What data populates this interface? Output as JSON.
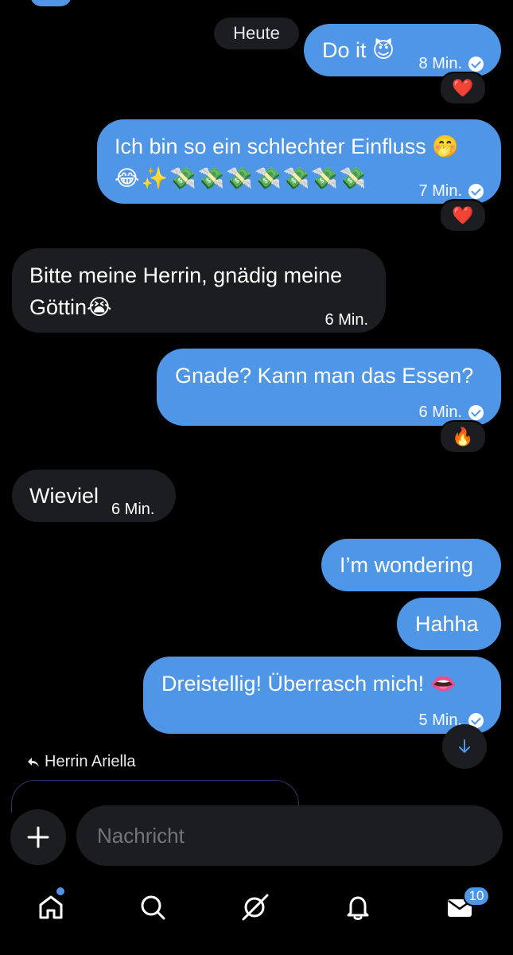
{
  "date_separator": "Heute",
  "messages": [
    {
      "text": "Do it 😈",
      "time": "8 Min.",
      "reaction": "❤️"
    },
    {
      "line1": "Ich bin so ein schlechter Einfluss 🤭",
      "line2": "😂✨💸💸💸💸💸💸💸",
      "time": "7 Min.",
      "reaction": "❤️"
    },
    {
      "line1": "Bitte meine Herrin, gnädig meine",
      "line2": "Göttin😭",
      "time": "6 Min."
    },
    {
      "text": "Gnade? Kann man das Essen?",
      "time": "6 Min.",
      "reaction": "🔥"
    },
    {
      "text": "Wieviel",
      "time": "6 Min."
    },
    {
      "text": "I’m wondering"
    },
    {
      "text": "Hahha"
    },
    {
      "text": "Dreistellig!  Überrasch mich! 👄",
      "time": "5 Min."
    }
  ],
  "reply": {
    "label": "Herrin Ariella"
  },
  "composer": {
    "placeholder": "Nachricht"
  },
  "nav": {
    "messages_badge": "10"
  },
  "colors": {
    "accent": "#4f96e6",
    "bubble_incoming": "#1c1d20",
    "background": "#000000"
  }
}
